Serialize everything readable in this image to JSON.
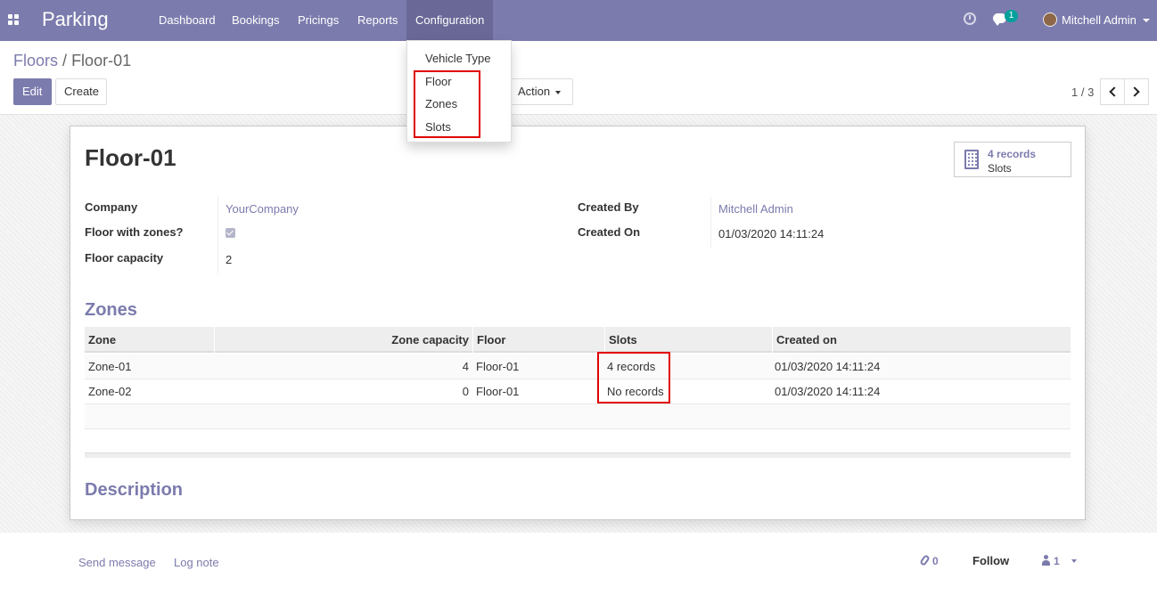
{
  "app": {
    "title": "Parking",
    "menu": [
      "Dashboard",
      "Bookings",
      "Pricings",
      "Reports",
      "Configuration"
    ],
    "active_menu": "Configuration",
    "chat_badge": "1",
    "user_name": "Mitchell Admin"
  },
  "config_menu": {
    "items": [
      "Vehicle Type",
      "Floor",
      "Zones",
      "Slots"
    ]
  },
  "breadcrumb": {
    "parent": "Floors",
    "separator": "/",
    "current": "Floor-01"
  },
  "buttons": {
    "edit": "Edit",
    "create": "Create",
    "action": "Action"
  },
  "pager": {
    "value": "1 / 3"
  },
  "smart_button": {
    "value": "4 records",
    "label": "Slots"
  },
  "record": {
    "name": "Floor-01",
    "fields": {
      "company_label": "Company",
      "company_value": "YourCompany",
      "floor_with_zones_label": "Floor with zones?",
      "floor_with_zones_value": true,
      "floor_capacity_label": "Floor capacity",
      "floor_capacity_value": "2",
      "created_by_label": "Created By",
      "created_by_value": "Mitchell Admin",
      "created_on_label": "Created On",
      "created_on_value": "01/03/2020 14:11:24"
    }
  },
  "zones": {
    "title": "Zones",
    "columns": [
      "Zone",
      "Zone capacity",
      "Floor",
      "Slots",
      "Created on"
    ],
    "rows": [
      [
        "Zone-01",
        "4",
        "Floor-01",
        "4 records",
        "01/03/2020 14:11:24"
      ],
      [
        "Zone-02",
        "0",
        "Floor-01",
        "No records",
        "01/03/2020 14:11:24"
      ]
    ]
  },
  "description": {
    "title": "Description"
  },
  "chatter": {
    "send_message": "Send message",
    "log_note": "Log note",
    "attachments": "0",
    "follow": "Follow",
    "followers": "1"
  },
  "colors": {
    "brand": "#7c7bad",
    "highlight": "#e00000"
  }
}
